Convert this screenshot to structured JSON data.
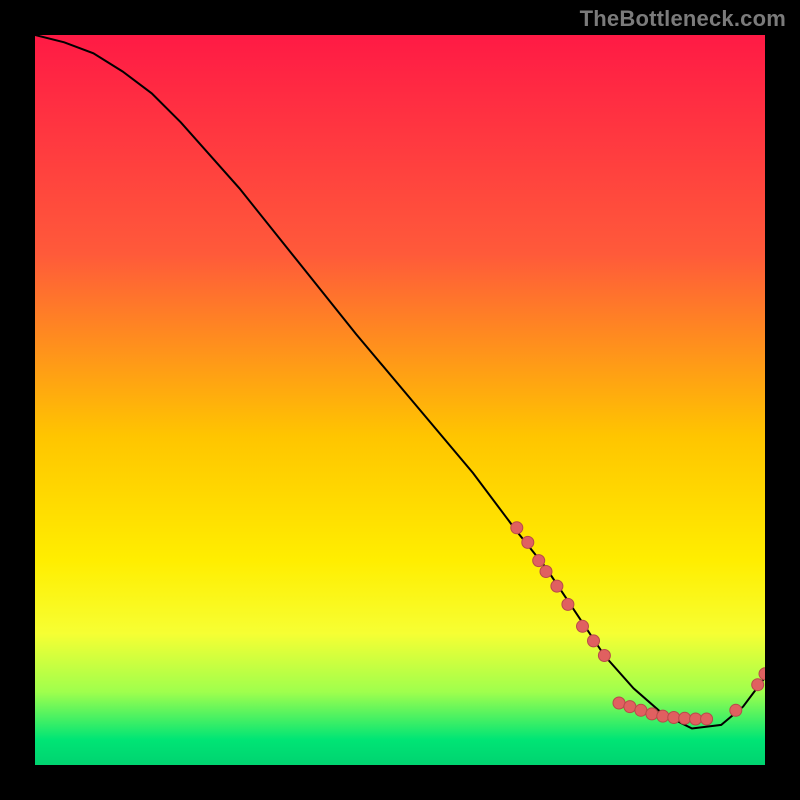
{
  "watermark": "TheBottleneck.com",
  "chart_data": {
    "type": "line",
    "title": "",
    "xlabel": "",
    "ylabel": "",
    "xlim": [
      0,
      100
    ],
    "ylim": [
      0,
      100
    ],
    "grid": false,
    "legend": false,
    "gradient_stops": [
      {
        "offset": 0.0,
        "color": "#ff1a45"
      },
      {
        "offset": 0.3,
        "color": "#ff5a3a"
      },
      {
        "offset": 0.55,
        "color": "#ffc500"
      },
      {
        "offset": 0.72,
        "color": "#ffee00"
      },
      {
        "offset": 0.82,
        "color": "#f6ff33"
      },
      {
        "offset": 0.9,
        "color": "#9fff4d"
      },
      {
        "offset": 0.965,
        "color": "#00e575"
      },
      {
        "offset": 1.0,
        "color": "#00d370"
      }
    ],
    "series": [
      {
        "name": "curve",
        "color": "#000000",
        "x": [
          0,
          4,
          8,
          12,
          16,
          20,
          28,
          36,
          44,
          52,
          60,
          66,
          70,
          74,
          78,
          82,
          86,
          90,
          94,
          97,
          100
        ],
        "y": [
          100,
          99,
          97.5,
          95,
          92,
          88,
          79,
          69,
          59,
          49.5,
          40,
          32,
          27,
          21,
          15,
          10.5,
          7,
          5,
          5.5,
          8,
          12
        ]
      }
    ],
    "markers": {
      "color": "#e06060",
      "stroke": "#b84a4a",
      "radius": 6,
      "points_xy": [
        [
          66,
          32.5
        ],
        [
          67.5,
          30.5
        ],
        [
          69,
          28
        ],
        [
          70,
          26.5
        ],
        [
          71.5,
          24.5
        ],
        [
          73,
          22
        ],
        [
          75,
          19
        ],
        [
          76.5,
          17
        ],
        [
          78,
          15
        ],
        [
          80,
          8.5
        ],
        [
          81.5,
          8
        ],
        [
          83,
          7.5
        ],
        [
          84.5,
          7
        ],
        [
          86,
          6.7
        ],
        [
          87.5,
          6.5
        ],
        [
          89,
          6.4
        ],
        [
          90.5,
          6.3
        ],
        [
          92,
          6.3
        ],
        [
          96,
          7.5
        ],
        [
          99,
          11
        ],
        [
          100,
          12.5
        ]
      ]
    }
  }
}
